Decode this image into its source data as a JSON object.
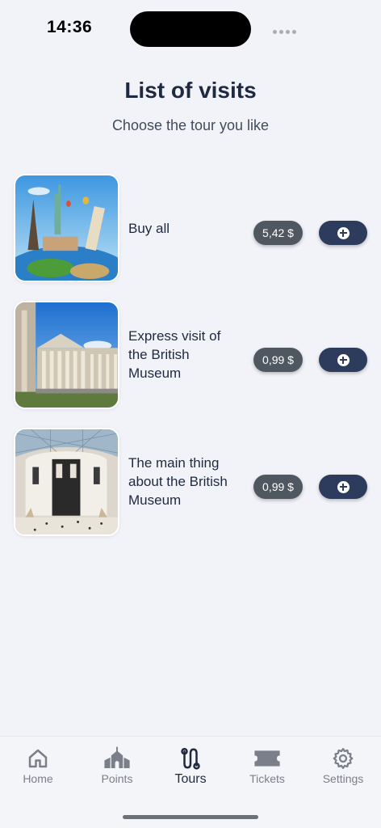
{
  "status_bar": {
    "time": "14:36"
  },
  "header": {
    "title": "List of visits",
    "subtitle": "Choose the tour you like"
  },
  "tours": [
    {
      "name": "Buy all",
      "price": "5,42 $",
      "image": "world-landmarks"
    },
    {
      "name": "Express visit of the British Museum",
      "price": "0,99 $",
      "image": "british-museum-facade"
    },
    {
      "name": "The main thing about the British Museum",
      "price": "0,99 $",
      "image": "great-court"
    }
  ],
  "tab_bar": {
    "active": "Tours",
    "items": [
      {
        "label": "Home",
        "icon": "home-icon"
      },
      {
        "label": "Points",
        "icon": "church-icon"
      },
      {
        "label": "Tours",
        "icon": "route-icon"
      },
      {
        "label": "Tickets",
        "icon": "ticket-icon"
      },
      {
        "label": "Settings",
        "icon": "gear-icon"
      }
    ]
  },
  "colors": {
    "background": "#f1f3f8",
    "price_badge": "#4f5861",
    "add_button": "#2d3b5c",
    "title_text": "#1f2940"
  }
}
